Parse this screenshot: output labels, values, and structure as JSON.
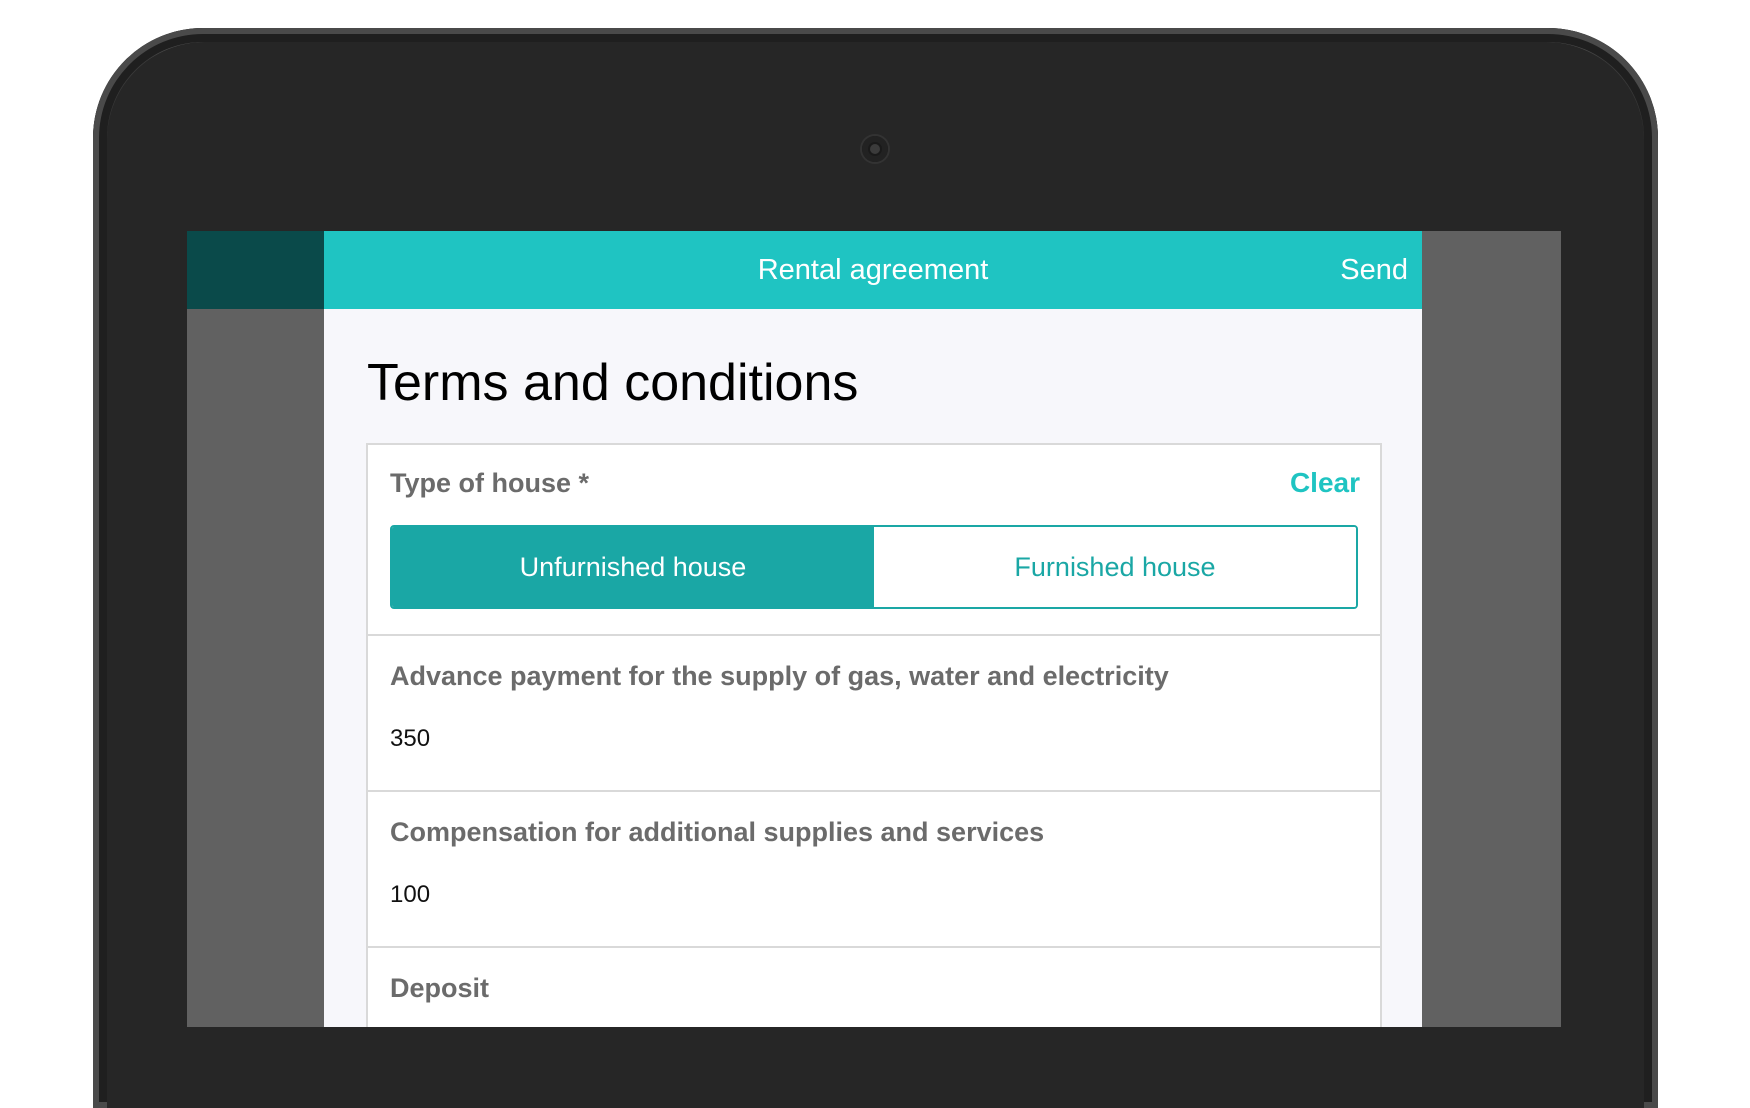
{
  "header": {
    "title": "Rental agreement",
    "send_label": "Send"
  },
  "page": {
    "title": "Terms and conditions"
  },
  "form": {
    "type_of_house": {
      "label": "Type of house *",
      "clear_label": "Clear",
      "options": [
        "Unfurnished house",
        "Furnished house"
      ],
      "selected": "Unfurnished house"
    },
    "advance_payment": {
      "label": "Advance payment for the supply of gas, water and electricity",
      "value": "350"
    },
    "compensation": {
      "label": "Compensation for additional supplies and services",
      "value": "100"
    },
    "deposit": {
      "label": "Deposit"
    }
  },
  "colors": {
    "accent": "#1fc4c2",
    "accent_dark": "#1aa7a5",
    "sidebar_dark": "#0a4a4a"
  }
}
